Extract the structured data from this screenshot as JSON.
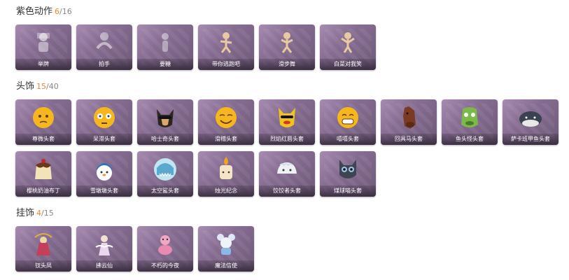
{
  "sections": [
    {
      "title": "紫色动作",
      "owned": "6",
      "total": "/16",
      "items": [
        {
          "name": "举牌",
          "icon": "sign-pose-icon"
        },
        {
          "name": "拍手",
          "icon": "clap-pose-icon"
        },
        {
          "name": "要糖",
          "icon": "ask-candy-pose-icon"
        },
        {
          "name": "带你逃跑吧",
          "icon": "run-away-pose-icon"
        },
        {
          "name": "滑步舞",
          "icon": "slide-dance-pose-icon"
        },
        {
          "name": "白菜对我笑",
          "icon": "cabbage-laugh-pose-icon"
        }
      ]
    },
    {
      "title": "头饰",
      "owned": "15",
      "total": "/40",
      "items": [
        {
          "name": "尊微头套",
          "icon": "shy-emoji-head-icon"
        },
        {
          "name": "呆滞头套",
          "icon": "dazed-emoji-head-icon"
        },
        {
          "name": "哈士奇头套",
          "icon": "husky-head-icon"
        },
        {
          "name": "滑稽头套",
          "icon": "funny-emoji-head-icon"
        },
        {
          "name": "烈焰红唇头套",
          "icon": "red-lips-head-icon"
        },
        {
          "name": "嘻嘻头套",
          "icon": "grin-emoji-head-icon"
        },
        {
          "name": "回具马头套",
          "icon": "horse-head-icon"
        },
        {
          "name": "鱼头怪头套",
          "icon": "fish-monster-head-icon"
        },
        {
          "name": "萨卡班甲鱼头套",
          "icon": "sacabambaspis-head-icon"
        },
        {
          "name": "樱桃奶油布丁",
          "icon": "cherry-pudding-head-icon"
        },
        {
          "name": "雪墩墩头套",
          "icon": "snow-head-icon"
        },
        {
          "name": "太空鲨头套",
          "icon": "space-shark-head-icon"
        },
        {
          "name": "烛光纪念",
          "icon": "candle-head-icon"
        },
        {
          "name": "饺饺者头套",
          "icon": "dumpling-head-icon"
        },
        {
          "name": "煤球喵头套",
          "icon": "coal-cat-head-icon"
        }
      ]
    },
    {
      "title": "挂饰",
      "owned": "4",
      "total": "/15",
      "items": [
        {
          "name": "钗头凤",
          "icon": "phoenix-charm-icon"
        },
        {
          "name": "拂云仙",
          "icon": "cloud-fairy-charm-icon"
        },
        {
          "name": "不朽的今夜",
          "icon": "eternal-tonight-charm-icon"
        },
        {
          "name": "魔法信使",
          "icon": "magic-messenger-charm-icon"
        }
      ]
    }
  ]
}
